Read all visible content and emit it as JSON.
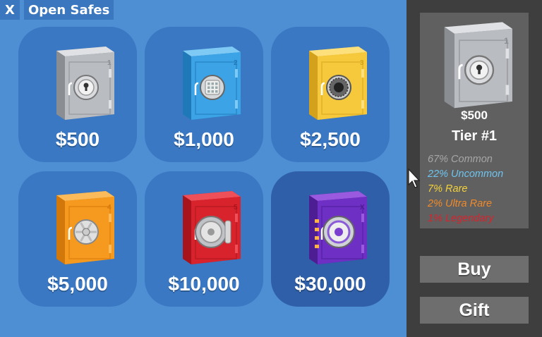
{
  "header": {
    "close_label": "X",
    "title": "Open Safes"
  },
  "safes": [
    {
      "price": "$500",
      "number": "1",
      "body": "#b9bcc1",
      "dark": "#8a8d92",
      "light": "#dfe1e4",
      "lock": "keyhole"
    },
    {
      "price": "$1,000",
      "number": "2",
      "body": "#3ba3e6",
      "dark": "#1f78b8",
      "light": "#7fcaf5",
      "lock": "keypad"
    },
    {
      "price": "$2,500",
      "number": "3",
      "body": "#f6c93d",
      "dark": "#d3a11b",
      "light": "#fde07c",
      "lock": "dial"
    },
    {
      "price": "$5,000",
      "number": "4",
      "body": "#f59a1e",
      "dark": "#d2770a",
      "light": "#fbbb5a",
      "lock": "wheel"
    },
    {
      "price": "$10,000",
      "number": "5",
      "body": "#d8232d",
      "dark": "#a8141c",
      "light": "#ee5059",
      "lock": "vault"
    },
    {
      "price": "$30,000",
      "number": "X",
      "body": "#6e2fc4",
      "dark": "#4d1d93",
      "light": "#9a5ae0",
      "lock": "vault-glow"
    }
  ],
  "selected": {
    "price": "$500",
    "tier": "Tier #1",
    "odds": [
      {
        "label": "67% Common",
        "color": "#a6a6a6"
      },
      {
        "label": "22% Uncommon",
        "color": "#6fc4ef"
      },
      {
        "label": "7% Rare",
        "color": "#f5d23a"
      },
      {
        "label": "2% Ultra Rare",
        "color": "#f08a2a"
      },
      {
        "label": "1% Legendary",
        "color": "#d8232d"
      }
    ]
  },
  "actions": {
    "buy_label": "Buy",
    "gift_label": "Gift"
  }
}
